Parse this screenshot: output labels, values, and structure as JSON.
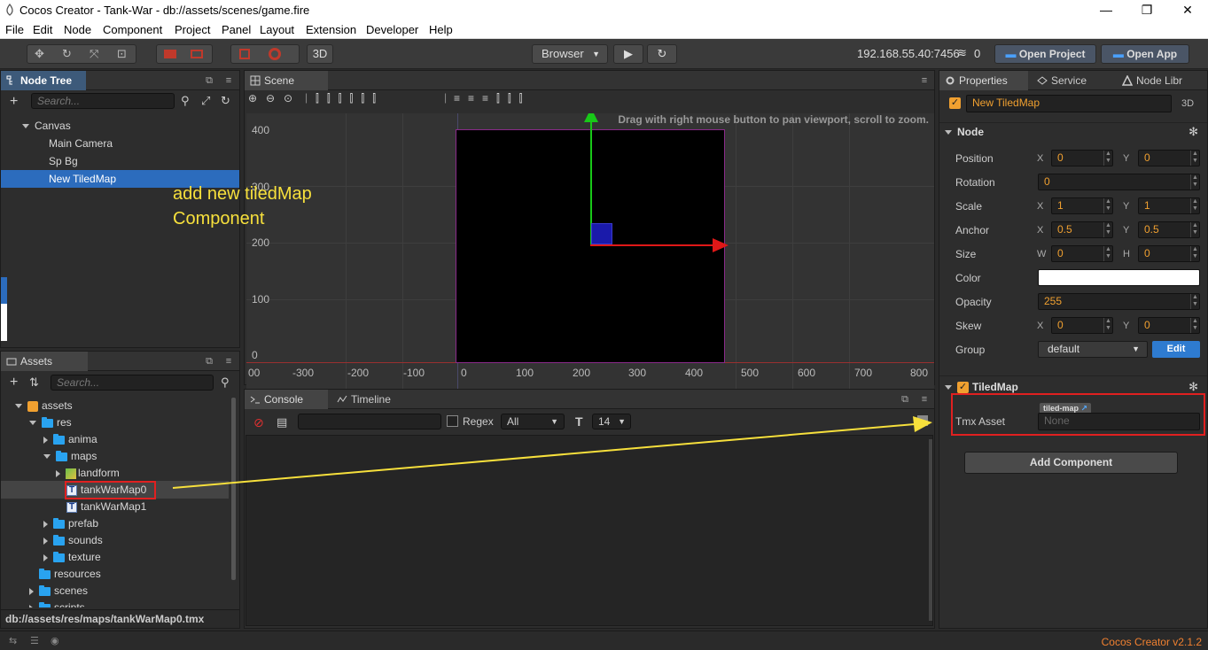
{
  "window": {
    "title": "Cocos Creator - Tank-War - db://assets/scenes/game.fire",
    "minimize": "—",
    "restore": "❐",
    "close": "✕"
  },
  "menu": [
    "File",
    "Edit",
    "Node",
    "Component",
    "Project",
    "Panel",
    "Layout",
    "Extension",
    "Developer",
    "Help"
  ],
  "toolbar": {
    "mode_3d": "3D",
    "preview_target": "Browser",
    "ip": "192.168.55.40:7456",
    "conn_count": "0",
    "open_project": "Open Project",
    "open_app": "Open App"
  },
  "node_tree": {
    "tab": "Node Tree",
    "search_placeholder": "Search...",
    "items": [
      {
        "label": "Canvas"
      },
      {
        "label": "Main Camera"
      },
      {
        "label": "Sp Bg"
      },
      {
        "label": "New TiledMap"
      }
    ]
  },
  "assets": {
    "tab": "Assets",
    "search_placeholder": "Search...",
    "items": [
      {
        "label": "assets"
      },
      {
        "label": "res"
      },
      {
        "label": "anima"
      },
      {
        "label": "maps"
      },
      {
        "label": "landform"
      },
      {
        "label": "tankWarMap0"
      },
      {
        "label": "tankWarMap1"
      },
      {
        "label": "prefab"
      },
      {
        "label": "sounds"
      },
      {
        "label": "texture"
      },
      {
        "label": "resources"
      },
      {
        "label": "scenes"
      },
      {
        "label": "scripts"
      }
    ],
    "path": "db://assets/res/maps/tankWarMap0.tmx"
  },
  "scene": {
    "tab": "Scene",
    "hint": "Drag with right mouse button to pan viewport, scroll to zoom.",
    "y_labels": [
      "400",
      "300",
      "200",
      "100",
      "0"
    ],
    "x_labels": [
      "00",
      "-300",
      "-200",
      "-100",
      "0",
      "100",
      "200",
      "300",
      "400",
      "500",
      "600",
      "700",
      "800"
    ]
  },
  "annotation": {
    "line1": "add new tiledMap",
    "line2": "Component",
    "color": "#f7e03c"
  },
  "console": {
    "tab": "Console",
    "tab2": "Timeline",
    "regex_label": "Regex",
    "level": "All",
    "font_size": "14"
  },
  "properties": {
    "tabs": [
      "Properties",
      "Service",
      "Node Libr"
    ],
    "node_name": "New TiledMap",
    "badge_3d": "3D",
    "node_section": "Node",
    "position": {
      "label": "Position",
      "x": "0",
      "y": "0"
    },
    "rotation": {
      "label": "Rotation",
      "value": "0"
    },
    "scale": {
      "label": "Scale",
      "x": "1",
      "y": "1"
    },
    "anchor": {
      "label": "Anchor",
      "x": "0.5",
      "y": "0.5"
    },
    "size": {
      "label": "Size",
      "w": "0",
      "h": "0"
    },
    "color": {
      "label": "Color",
      "value": "#ffffff"
    },
    "opacity": {
      "label": "Opacity",
      "value": "255"
    },
    "skew": {
      "label": "Skew",
      "x": "0",
      "y": "0"
    },
    "group": {
      "label": "Group",
      "value": "default",
      "edit": "Edit"
    },
    "tiledmap_section": "TiledMap",
    "tmx_asset": {
      "label": "Tmx Asset",
      "type": "tiled-map",
      "value": "None"
    },
    "add_component": "Add Component",
    "axis": {
      "x": "X",
      "y": "Y",
      "w": "W",
      "h": "H"
    }
  },
  "status": {
    "version": "Cocos Creator v2.1.2"
  }
}
